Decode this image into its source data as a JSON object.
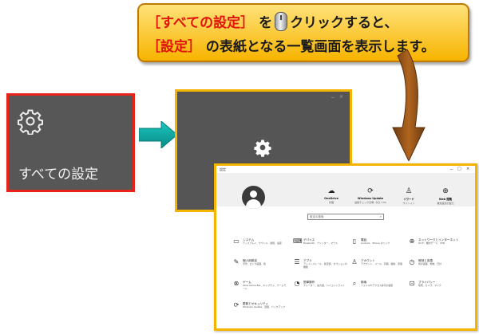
{
  "callout": {
    "l1_bracket_open": "［",
    "l1_term": "すべての設定",
    "l1_bracket_close": "］",
    "l1_o": "を",
    "l1_rest": "クリックすると、",
    "l2_bracket_open": "［",
    "l2_term": "設定",
    "l2_bracket_close": "］",
    "l2_rest": "の表紙となる一覧画面を表示します。"
  },
  "tile": {
    "label": "すべての設定"
  },
  "middle_window": {
    "minimize": "－",
    "close": "×"
  },
  "settings_window": {
    "title": "設定",
    "controls": [
      "－",
      "□",
      "×"
    ],
    "header_items": [
      {
        "icon": "☁",
        "title": "OneDrive",
        "sub": "管理"
      },
      {
        "icon": "⟳",
        "title": "Windows Update",
        "sub": "最終チェック日時: 今日 7:55"
      },
      {
        "icon": "♙",
        "title": "リワード",
        "sub": "サインイン"
      },
      {
        "icon": "⊕",
        "title": "Web 閲覧",
        "sub": "推奨設定の復元"
      }
    ],
    "search_placeholder": "設定の検索",
    "categories": [
      {
        "icon": "▭",
        "title": "システム",
        "sub": "ディスプレイ、サウンド、通知、電源"
      },
      {
        "icon": "⌨",
        "title": "デバイス",
        "sub": "Bluetooth、プリンター、マウス"
      },
      {
        "icon": "▯",
        "title": "電話",
        "sub": "Android、iPhone のリンク"
      },
      {
        "icon": "⊕",
        "title": "ネットワークとインターネット",
        "sub": "Wi-Fi、機内モード、VPN"
      },
      {
        "icon": "✎",
        "title": "個人用設定",
        "sub": "背景、ロック画面、色"
      },
      {
        "icon": "☰",
        "title": "アプリ",
        "sub": "アンインストール、既定値、オプションの機能"
      },
      {
        "icon": "♙",
        "title": "アカウント",
        "sub": "アカウント、メール、同期、職場、家族"
      },
      {
        "icon": "◷",
        "title": "時刻と言語",
        "sub": "音声認識、地域、日付"
      },
      {
        "icon": "⊗",
        "title": "ゲーム",
        "sub": "Xbox Game Bar、キャプチャ、ゲームモード"
      },
      {
        "icon": "◔",
        "title": "簡単操作",
        "sub": "ナレーター、拡大鏡、ハイコントラスト"
      },
      {
        "icon": "⌕",
        "title": "検索",
        "sub": "ファイルやアクセス許可の検索"
      },
      {
        "icon": "⊡",
        "title": "プライバシー",
        "sub": "場所、カメラ、マイク"
      },
      {
        "icon": "⟳",
        "title": "更新とセキュリティ",
        "sub": "Windows Update、回復、バックアップ"
      }
    ]
  },
  "colors": {
    "callout_bg": "#f7b400",
    "emphasis": "#e0140a",
    "frame_yellow": "#f4b400",
    "frame_red": "#e8231a",
    "arrow_teal": "#0fa5a0",
    "arrow_brown": "#8a4a12"
  }
}
